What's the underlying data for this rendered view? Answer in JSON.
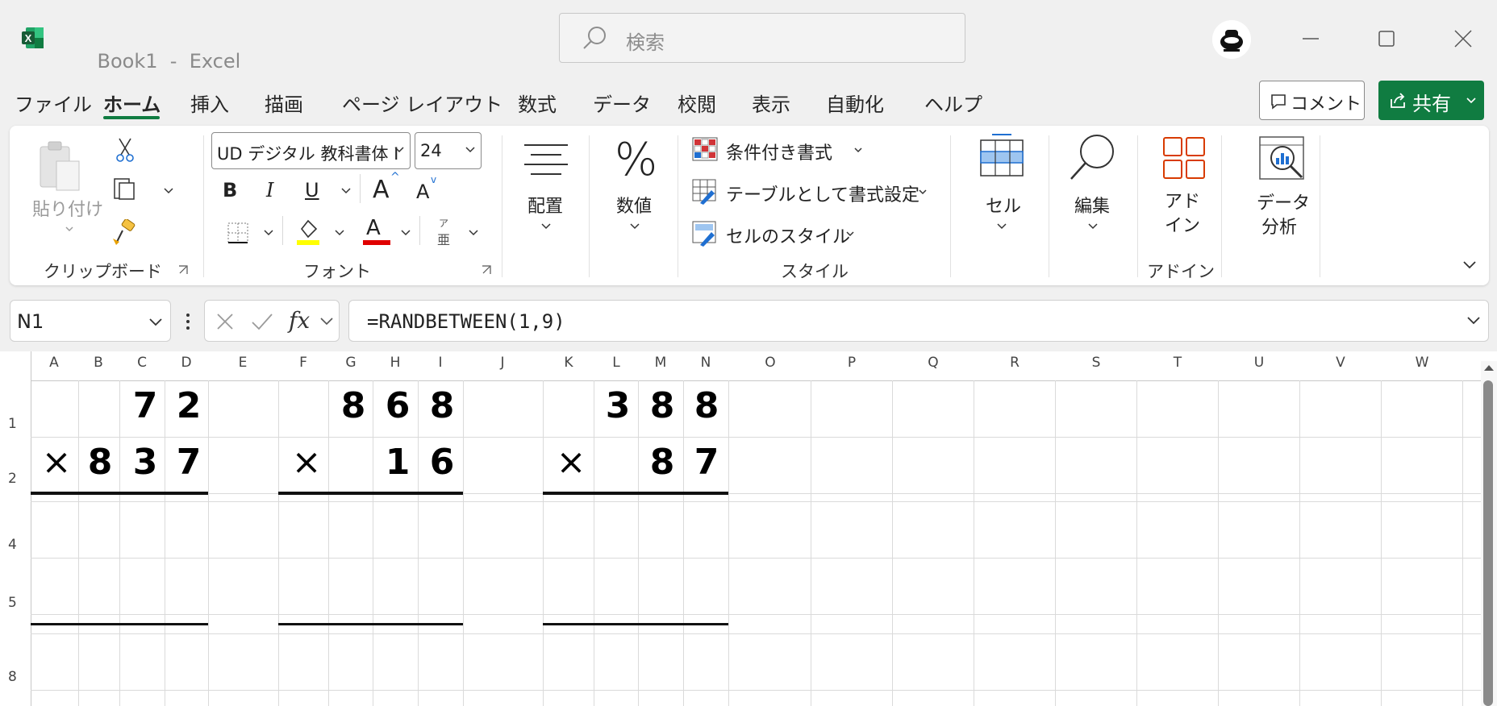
{
  "titlebar": {
    "doc_name": "Book1",
    "separator": "-",
    "app_name": "Excel",
    "search_placeholder": "検索",
    "app_icon": "excel-icon"
  },
  "tabs": [
    {
      "label": "ファイル"
    },
    {
      "label": "ホーム",
      "active": true
    },
    {
      "label": "挿入"
    },
    {
      "label": "描画"
    },
    {
      "label": "ページ レイアウト"
    },
    {
      "label": "数式"
    },
    {
      "label": "データ"
    },
    {
      "label": "校閲"
    },
    {
      "label": "表示"
    },
    {
      "label": "自動化"
    },
    {
      "label": "ヘルプ"
    }
  ],
  "actions": {
    "comment_label": "コメント",
    "share_label": "共有"
  },
  "ribbon": {
    "clipboard": {
      "paste_label": "貼り付け",
      "group_label": "クリップボード"
    },
    "font": {
      "font_name": "UD デジタル 教科書体 I",
      "font_size": "24",
      "bold": "B",
      "italic": "I",
      "underline": "U",
      "grow": "A",
      "shrink": "A",
      "font_color": "A",
      "phonetic_top": "ア",
      "phonetic_bottom": "亜",
      "group_label": "フォント"
    },
    "alignment": {
      "label": "配置"
    },
    "number": {
      "label": "数値",
      "symbol": "%"
    },
    "styles": {
      "conditional": "条件付き書式",
      "as_table": "テーブルとして書式設定",
      "cell_styles": "セルのスタイル",
      "group_label": "スタイル"
    },
    "cells": {
      "label": "セル"
    },
    "editing": {
      "label": "編集"
    },
    "addins": {
      "label_line1": "アド",
      "label_line2": "イン",
      "group_label": "アドイン"
    },
    "analysis": {
      "label_line1": "データ",
      "label_line2": "分析"
    }
  },
  "formula_bar": {
    "name_box": "N1",
    "fx": "fx",
    "formula": "=RANDBETWEEN(1,9)"
  },
  "sheet": {
    "columns": [
      "A",
      "B",
      "C",
      "D",
      "E",
      "F",
      "G",
      "H",
      "I",
      "J",
      "K",
      "L",
      "M",
      "N",
      "O",
      "P",
      "Q",
      "R",
      "S",
      "T",
      "U",
      "V",
      "W"
    ],
    "rows": [
      "1",
      "2",
      "4",
      "5",
      "8"
    ],
    "problems": [
      {
        "top": [
          "7",
          "2"
        ],
        "bottom": [
          "×",
          "8",
          "3",
          "7"
        ]
      },
      {
        "top": [
          "8",
          "6",
          "8"
        ],
        "bottom": [
          "×",
          "1",
          "6"
        ]
      },
      {
        "top": [
          "3",
          "8",
          "8"
        ],
        "bottom": [
          "×",
          "8",
          "7"
        ]
      }
    ]
  },
  "colors": {
    "accent": "#107c41",
    "tab_underline": "#107c41",
    "highlight_yellow": "#ffff00",
    "font_red": "#e00000",
    "style_red": "#d83b01"
  }
}
